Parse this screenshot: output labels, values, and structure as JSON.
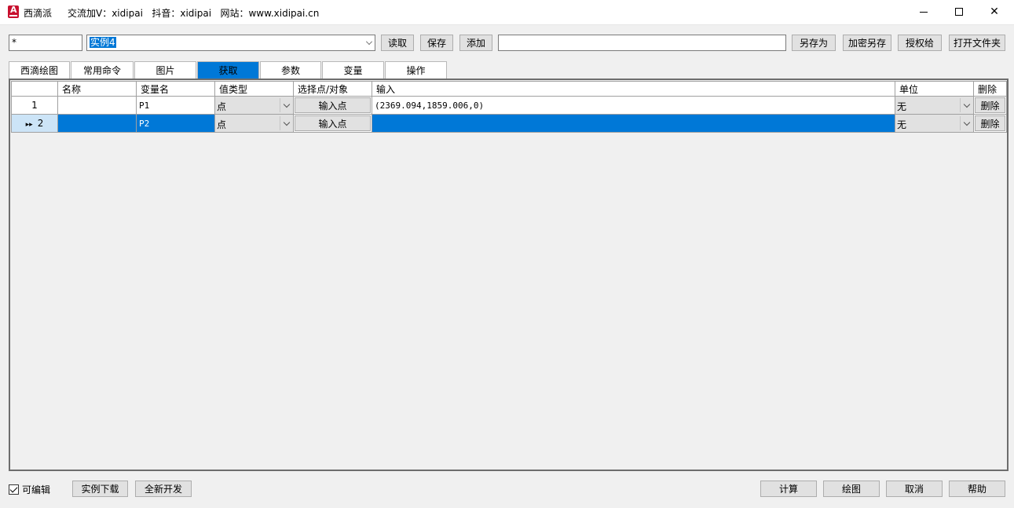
{
  "titlebar": {
    "app_name": "西滴派",
    "contact": "交流加V：xidipai   抖音：xidipai   网站：www.xidipai.cn",
    "icon": "autocad-icon"
  },
  "toolbar": {
    "filter_value": "*",
    "instance_value": "实例4",
    "read_label": "读取",
    "save_label": "保存",
    "add_label": "添加",
    "name_value": "",
    "save_as_label": "另存为",
    "encrypt_save_label": "加密另存",
    "authorize_label": "授权给",
    "open_folder_label": "打开文件夹"
  },
  "tabs": [
    {
      "label": "西滴绘图"
    },
    {
      "label": "常用命令"
    },
    {
      "label": "图片"
    },
    {
      "label": "获取",
      "active": true
    },
    {
      "label": "参数"
    },
    {
      "label": "变量"
    },
    {
      "label": "操作"
    }
  ],
  "grid": {
    "headers": [
      "",
      "名称",
      "变量名",
      "值类型",
      "选择点/对象",
      "输入",
      "单位",
      "删除"
    ],
    "rows": [
      {
        "index": "1",
        "name": "",
        "var": "P1",
        "type": "点",
        "pick": "输入点",
        "input": "(2369.094,1859.006,0)",
        "unit": "无",
        "delete": "删除"
      },
      {
        "index": "2",
        "marker": "▸▸",
        "name": "",
        "var": "P2",
        "type": "点",
        "pick": "输入点",
        "input": "",
        "unit": "无",
        "delete": "删除"
      }
    ]
  },
  "footer": {
    "editable_label": "可编辑",
    "editable_checked": true,
    "download_label": "实例下载",
    "new_dev_label": "全新开发",
    "calc_label": "计算",
    "draw_label": "绘图",
    "cancel_label": "取消",
    "help_label": "帮助"
  },
  "colors": {
    "accent": "#0078d7",
    "selected_row_header": "#cce4f7",
    "button_bg": "#e1e1e1"
  }
}
